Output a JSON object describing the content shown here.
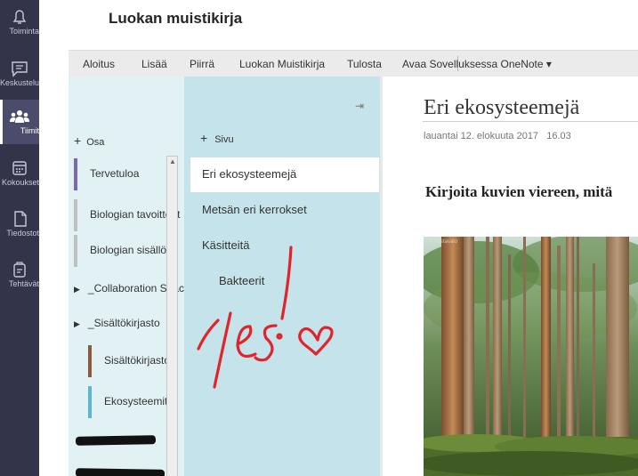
{
  "teams_rail": {
    "items": [
      {
        "label": "Toiminta",
        "icon": "bell-icon",
        "active": false
      },
      {
        "label": "Keskustelu",
        "icon": "chat-icon",
        "active": false
      },
      {
        "label": "Tiimit",
        "icon": "teams-icon",
        "active": true
      },
      {
        "label": "Kokoukset",
        "icon": "calendar-icon",
        "active": false
      },
      {
        "label": "Tiedostot",
        "icon": "file-icon",
        "active": false
      },
      {
        "label": "Tehtävät",
        "icon": "assignment-icon",
        "active": false
      }
    ]
  },
  "header": {
    "title": "Luokan muistikirja"
  },
  "ribbon": {
    "tabs": [
      "Aloitus",
      "Lisää",
      "Piirrä",
      "Luokan Muistikirja",
      "Tulosta",
      "Avaa Sovelluksessa OneNote ▾"
    ]
  },
  "sections": {
    "add_label": "Osa",
    "items": [
      {
        "label": "Tervetuloa",
        "color": "#7b68b0"
      },
      {
        "label": "Biologian tavoitteet",
        "color": "#c0c0c0"
      },
      {
        "label": "Biologian sisällöt",
        "color": "#c0c0c0"
      },
      {
        "label": "_Collaboration Space",
        "group": true
      },
      {
        "label": "_Sisältökirjasto",
        "group": true
      },
      {
        "label": "Sisältökirjasto",
        "color": "#8b5a3c"
      },
      {
        "label": "Ekosysteemit",
        "color": "#5ab9d0"
      }
    ]
  },
  "pages": {
    "add_label": "Sivu",
    "items": [
      {
        "label": "Eri ekosysteemejä",
        "selected": true,
        "level": 1
      },
      {
        "label": "Metsän eri kerrokset",
        "selected": false,
        "level": 1
      },
      {
        "label": "Käsitteitä",
        "selected": false,
        "level": 1
      },
      {
        "label": "Bakteerit",
        "selected": false,
        "level": 2
      }
    ]
  },
  "page": {
    "title": "Eri ekosysteemejä",
    "date": "lauantai 12. elokuuta 2017",
    "time": "16.03",
    "body": "Kirjoita kuvien viereen, mitä",
    "image": "forest-photo",
    "image_watermark": "© Vastavalo"
  },
  "ink_annotation": {
    "text": "Yes!",
    "color": "#e2242a"
  },
  "colors": {
    "rail": "#33344a",
    "sections_bg": "#e1f1f4",
    "pages_bg": "#c5e3ea",
    "ribbon_bg": "#ebebeb"
  }
}
